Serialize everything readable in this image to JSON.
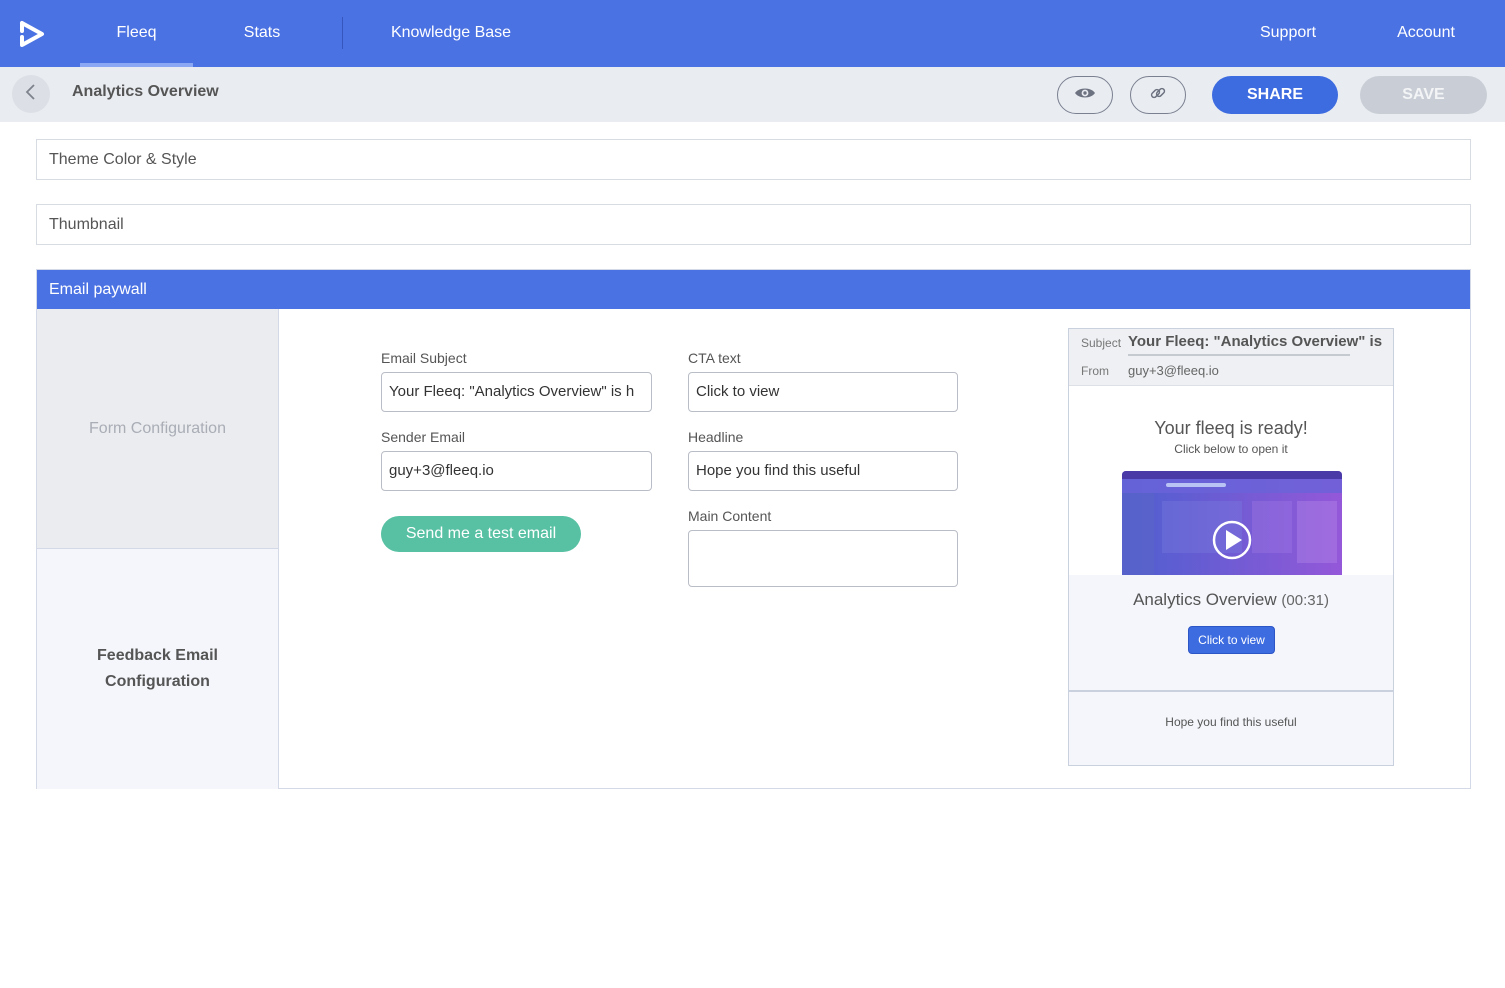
{
  "nav": {
    "items": [
      {
        "label": "Fleeq",
        "active": true
      },
      {
        "label": "Stats"
      },
      {
        "label": "Knowledge Base"
      },
      {
        "label": "Support"
      },
      {
        "label": "Account"
      }
    ]
  },
  "toolbar": {
    "title": "Analytics Overview",
    "share_label": "SHARE",
    "save_label": "SAVE"
  },
  "panels": {
    "theme": "Theme Color & Style",
    "thumbnail": "Thumbnail",
    "paywall": "Email paywall"
  },
  "side_tabs": {
    "form_config": "Form Configuration",
    "feedback_line1": "Feedback Email",
    "feedback_line2": "Configuration"
  },
  "form": {
    "email_subject_label": "Email Subject",
    "email_subject_value": "Your Fleeq: \"Analytics Overview\" is h",
    "sender_email_label": "Sender Email",
    "sender_email_value": "guy+3@fleeq.io",
    "cta_text_label": "CTA text",
    "cta_text_value": "Click to view",
    "headline_label": "Headline",
    "headline_value": "Hope you find this useful",
    "main_content_label": "Main Content",
    "main_content_value": "",
    "test_email_label": "Send me a test email"
  },
  "preview": {
    "subject_label": "Subject",
    "subject_value": "Your Fleeq: \"Analytics Overview\" is",
    "from_label": "From",
    "from_value": "guy+3@fleeq.io",
    "headline": "Your fleeq is ready!",
    "subline": "Click below to open it",
    "video_title": "Analytics Overview",
    "video_duration": "(00:31)",
    "cta": "Click to view",
    "footer": "Hope you find this useful"
  },
  "colors": {
    "brand": "#4b72e3",
    "share": "#3d6be0",
    "test_button": "#58c1a3",
    "save_disabled": "#c9ced6"
  }
}
